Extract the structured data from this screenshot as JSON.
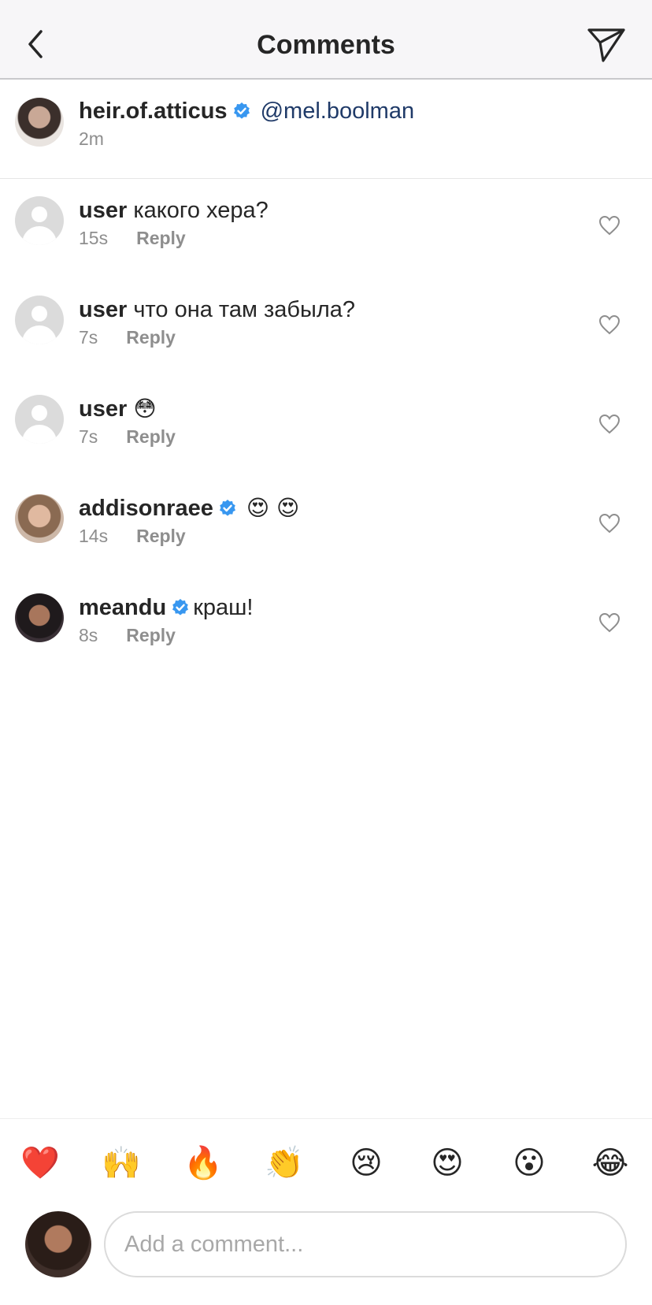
{
  "header": {
    "title": "Comments",
    "back_icon": "chevron-left-icon",
    "send_icon": "paper-plane-icon"
  },
  "caption": {
    "username": "heir.of.atticus",
    "verified": true,
    "mention": "@mel.boolman",
    "time": "2m"
  },
  "comments": [
    {
      "username": "user",
      "verified": false,
      "text": "какого хера?",
      "time": "15s",
      "reply": "Reply"
    },
    {
      "username": "user",
      "verified": false,
      "text": "что она там забыла?",
      "time": "7s",
      "reply": "Reply"
    },
    {
      "username": "user",
      "verified": false,
      "text": "😳",
      "time": "7s",
      "reply": "Reply"
    },
    {
      "username": "addisonraee",
      "verified": true,
      "text": "😍 😍",
      "time": "14s",
      "reply": "Reply"
    },
    {
      "username": "meandu",
      "verified": true,
      "text": "краш!",
      "time": "8s",
      "reply": "Reply"
    }
  ],
  "reactions": [
    "❤️",
    "🙌",
    "🔥",
    "👏",
    "😢",
    "😍",
    "😮",
    "😂"
  ],
  "composer": {
    "placeholder": "Add a comment..."
  },
  "colors": {
    "verified": "#3897f0",
    "mention": "#1f3a68",
    "secondary_text": "#8e8e8e",
    "header_bg": "#f7f6f8"
  }
}
